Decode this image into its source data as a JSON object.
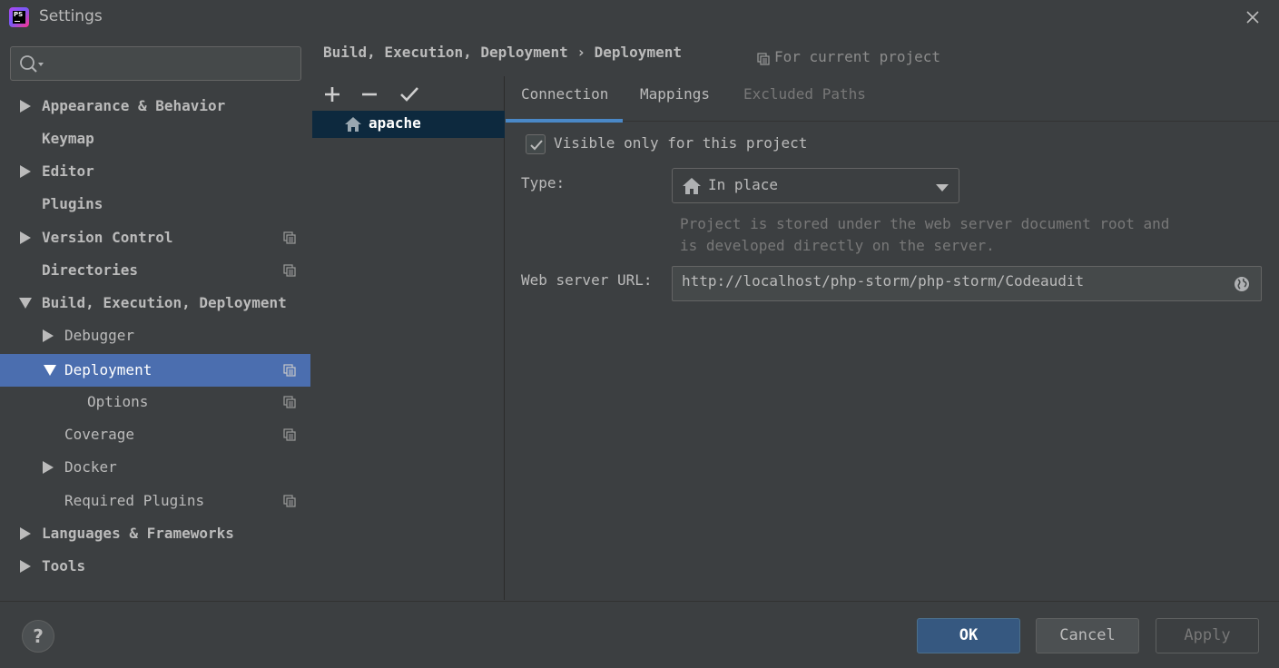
{
  "window": {
    "title": "Settings",
    "app_icon_text": "PS"
  },
  "search": {
    "placeholder": ""
  },
  "sidebar": {
    "items": [
      {
        "label": "Appearance & Behavior"
      },
      {
        "label": "Keymap"
      },
      {
        "label": "Editor"
      },
      {
        "label": "Plugins"
      },
      {
        "label": "Version Control"
      },
      {
        "label": "Directories"
      },
      {
        "label": "Build, Execution, Deployment"
      },
      {
        "label": "Debugger"
      },
      {
        "label": "Deployment"
      },
      {
        "label": "Options"
      },
      {
        "label": "Coverage"
      },
      {
        "label": "Docker"
      },
      {
        "label": "Required Plugins"
      },
      {
        "label": "Languages & Frameworks"
      },
      {
        "label": "Tools"
      }
    ]
  },
  "breadcrumb": {
    "parent": "Build, Execution, Deployment",
    "separator": "›",
    "current": "Deployment"
  },
  "for_project": "For current project",
  "servers": {
    "items": [
      {
        "name": "apache"
      }
    ]
  },
  "tabs": [
    {
      "label": "Connection"
    },
    {
      "label": "Mappings"
    },
    {
      "label": "Excluded Paths"
    }
  ],
  "connection": {
    "visible_only_label": "Visible only for this project",
    "visible_only_checked": true,
    "type_label": "Type:",
    "type_value": "In place",
    "description_line1": "Project is stored under the web server document root and",
    "description_line2": "is developed directly on the server.",
    "url_label": "Web server URL:",
    "url_value": "http://localhost/php-storm/php-storm/Codeaudit"
  },
  "footer": {
    "help_label": "?",
    "ok_label": "OK",
    "cancel_label": "Cancel",
    "apply_label": "Apply"
  },
  "colors": {
    "selection": "#4b6eaf",
    "tab_underline": "#4a88c7",
    "ok_button": "#365880",
    "server_selection": "#0d293e"
  }
}
